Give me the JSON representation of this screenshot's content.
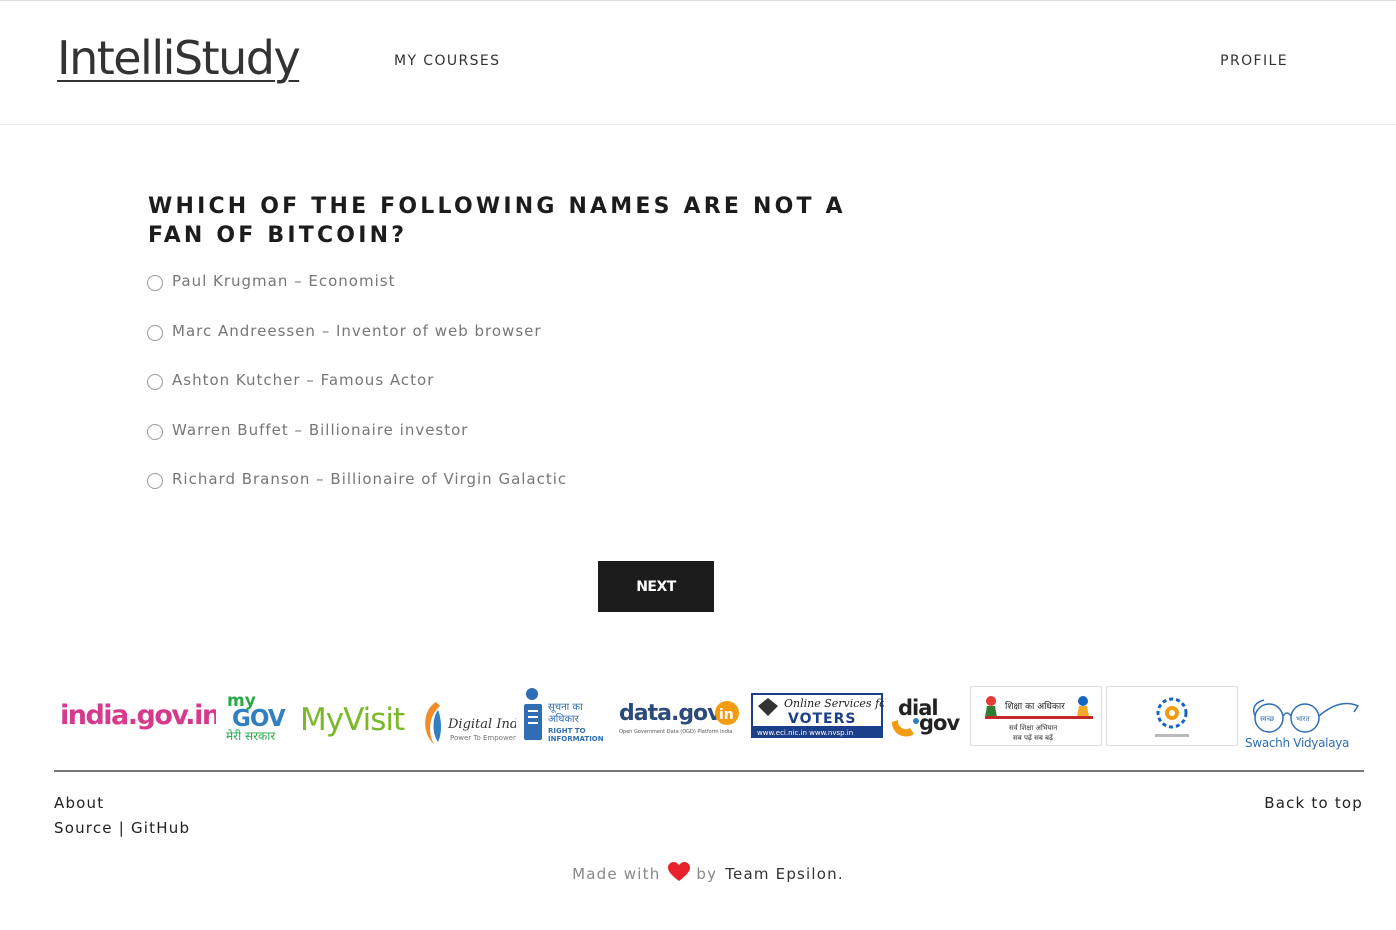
{
  "brand": {
    "logo_text": "IntelliStudy"
  },
  "nav": {
    "courses_label": "MY COURSES",
    "profile_label": "PROFILE"
  },
  "quiz": {
    "question": "WHICH OF THE FOLLOWING NAMES ARE NOT A FAN OF BITCOIN?",
    "options": [
      "Paul Krugman – Economist",
      "Marc Andreessen – Inventor of web browser",
      "Ashton Kutcher – Famous Actor",
      "Warren Buffet – Billionaire investor",
      "Richard Branson – Billionaire of Virgin Galactic"
    ],
    "next_label": "NEXT"
  },
  "partners": {
    "india_gov": "india.gov.in",
    "mygov_top": "my",
    "mygov_main": "GOV",
    "mygov_hindi": "मेरी सरकार",
    "myvisit": "MyVisit",
    "digital_india": "Digital India",
    "digital_india_tag": "Power To Empower",
    "rti_hindi_1": "सूचना का",
    "rti_hindi_2": "अधिकार",
    "rti_en_1": "RIGHT TO",
    "rti_en_2": "INFORMATION",
    "datagov": "data.gov",
    "datagov_in": "in",
    "datagov_tag": "Open Government Data (OGD) Platform India",
    "voters_top": "Online Services for",
    "voters_main": "VOTERS",
    "voters_url": "www.eci.nic.in  www.nvsp.in",
    "dialgov_1": "dial",
    "dialgov_2": "gov",
    "shiksha_1": "शिक्षा का अधिकार",
    "shiksha_2": "सर्व शिक्षा अभियान",
    "shiksha_3": "सब पढ़ें सब बढ़ें",
    "swachh_1": "स्वच्छ",
    "swachh_2": "भारत",
    "swachh_label": "Swachh Vidyalaya"
  },
  "footer": {
    "about": "About",
    "source": "Source",
    "separator": "|",
    "github": "GitHub",
    "back_to_top": "Back to top",
    "made_with": "Made with",
    "by": "by",
    "team": "Team Epsilon."
  },
  "colors": {
    "button_bg": "#1c1c1c",
    "heart": "#e8212a",
    "divider": "#777777"
  }
}
